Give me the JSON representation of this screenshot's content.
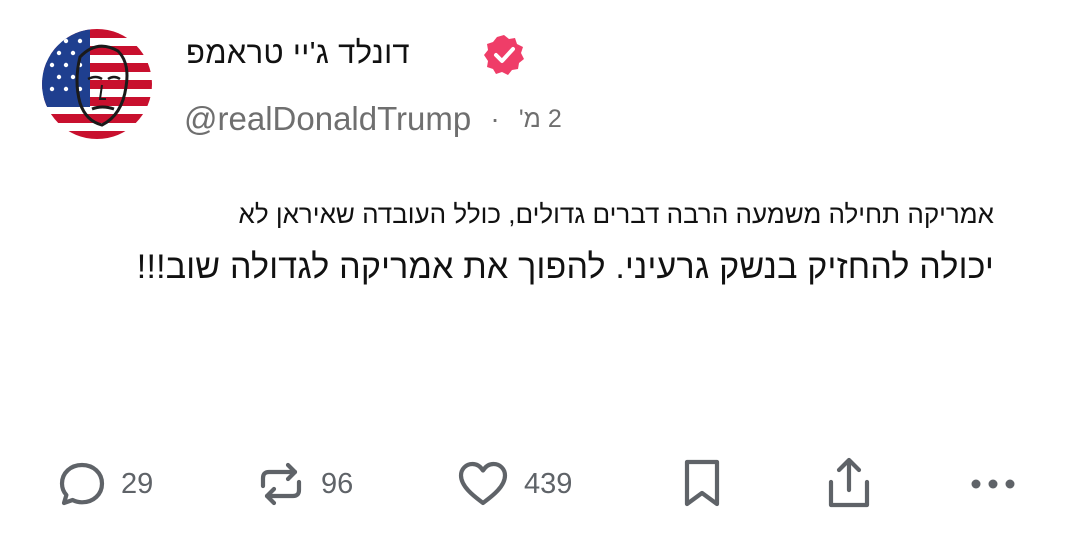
{
  "post": {
    "author": {
      "display_name": "דונלד ג'יי טראמפ",
      "handle": "@realDonaldTrump",
      "verified": true,
      "verified_color": "#ef3d68"
    },
    "separator": "·",
    "time_ago": "2 מ'",
    "text_line_1": "אמריקה תחילה משמעה הרבה דברים גדולים, כולל העובדה שאיראן לא",
    "text_line_2": "יכולה להחזיק בנשק גרעיני. להפוך את אמריקה לגדולה שוב!!!"
  },
  "actions": {
    "replies": "29",
    "reposts": "96",
    "likes": "439"
  },
  "icons": {
    "reply": "speech-bubble-icon",
    "repost": "repost-arrows-icon",
    "like": "heart-icon",
    "save": "bookmark-icon",
    "share": "share-upload-icon",
    "more": "more-dots-icon"
  },
  "colors": {
    "text": "#111111",
    "muted": "#6f6f6f",
    "icon": "#5f6368"
  }
}
